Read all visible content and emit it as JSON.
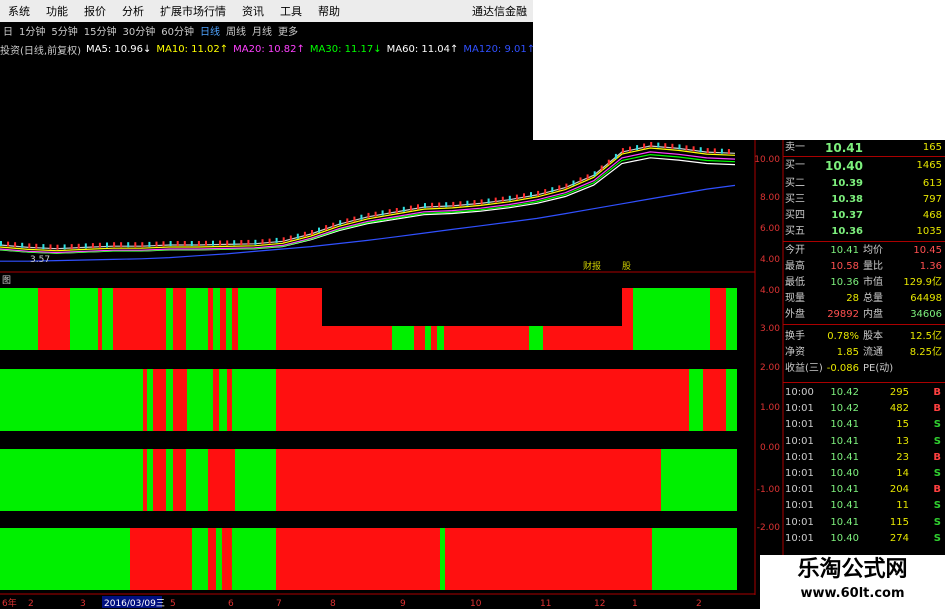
{
  "menu": {
    "items": [
      "系统",
      "功能",
      "报价",
      "分析",
      "扩展市场行情",
      "资讯",
      "工具",
      "帮助"
    ],
    "brand": "通达信金融"
  },
  "periods": {
    "items": [
      "日",
      "1分钟",
      "5分钟",
      "15分钟",
      "30分钟",
      "60分钟",
      "日线",
      "周线",
      "月线",
      "更多"
    ],
    "active_index": 6
  },
  "ma_bar": {
    "title": "投资(日线,前复权)",
    "ma5": "MA5: 10.96↓",
    "ma10": "MA10: 11.02↑",
    "ma20": "MA20: 10.82↑",
    "ma30": "MA30: 11.17↓",
    "ma60": "MA60: 11.04↑",
    "ma120": "MA120: 9.01↑",
    "colors": {
      "ma5": "#ffffff",
      "ma10": "#ffff00",
      "ma20": "#ff40ff",
      "ma30": "#00ff00",
      "ma60": "#ffffff",
      "ma120": "#3050ff"
    }
  },
  "price_chart": {
    "right_axis": [
      "10.00",
      "8.00",
      "6.00",
      "4.00"
    ],
    "low_label": "3.57",
    "markers": [
      "财报",
      "股"
    ],
    "series": {
      "ma120": [
        2.9,
        2.9,
        2.95,
        3.0,
        3.05,
        3.1,
        3.2,
        3.35,
        3.5,
        3.7,
        3.9,
        4.1,
        4.35,
        4.6,
        4.9,
        5.2,
        5.5,
        5.8,
        6.1,
        6.4,
        6.8,
        7.2,
        7.6,
        8.0,
        8.4,
        8.8,
        9.1
      ],
      "price": [
        3.9,
        3.7,
        3.6,
        3.7,
        3.8,
        3.8,
        3.9,
        3.9,
        3.95,
        4.0,
        4.2,
        4.8,
        5.6,
        6.2,
        6.6,
        7.0,
        7.1,
        7.3,
        7.6,
        8.0,
        8.6,
        9.6,
        11.5,
        12.0,
        11.8,
        11.5,
        11.4
      ]
    }
  },
  "indicator": {
    "label": "图",
    "axis_labels": [
      "4.00",
      "3.00",
      "2.00",
      "1.00",
      "0.00",
      "-1.00",
      "-2.00"
    ],
    "colors": {
      "red": "#ff1010",
      "green": "#00f000"
    },
    "rows": [
      {
        "segments": [
          [
            "g",
            0,
            38
          ],
          [
            "r",
            38,
            70
          ],
          [
            "g",
            70,
            98
          ],
          [
            "r",
            98,
            102
          ],
          [
            "g",
            102,
            113
          ],
          [
            "r",
            113,
            166
          ],
          [
            "g",
            166,
            173
          ],
          [
            "r",
            173,
            186
          ],
          [
            "g",
            186,
            208
          ],
          [
            "r",
            208,
            213
          ],
          [
            "g",
            213,
            220
          ],
          [
            "r",
            220,
            226
          ],
          [
            "g",
            226,
            232
          ],
          [
            "r",
            232,
            238
          ],
          [
            "g",
            238,
            276
          ],
          [
            "r",
            276,
            392
          ],
          [
            "g",
            392,
            414
          ],
          [
            "r",
            414,
            425
          ],
          [
            "g",
            425,
            431
          ],
          [
            "r",
            431,
            437
          ],
          [
            "g",
            437,
            444
          ],
          [
            "r",
            444,
            529
          ],
          [
            "g",
            529,
            543
          ],
          [
            "r",
            543,
            633
          ],
          [
            "g",
            633,
            710
          ],
          [
            "r",
            710,
            726
          ],
          [
            "g",
            726,
            737
          ]
        ]
      },
      {
        "segments": [
          [
            "g",
            0,
            143
          ],
          [
            "r",
            143,
            147
          ],
          [
            "g",
            147,
            153
          ],
          [
            "r",
            153,
            166
          ],
          [
            "g",
            166,
            173
          ],
          [
            "r",
            173,
            187
          ],
          [
            "g",
            187,
            213
          ],
          [
            "r",
            213,
            219
          ],
          [
            "g",
            219,
            227
          ],
          [
            "r",
            227,
            232
          ],
          [
            "g",
            232,
            276
          ],
          [
            "r",
            276,
            689
          ],
          [
            "g",
            689,
            703
          ],
          [
            "r",
            703,
            726
          ],
          [
            "g",
            726,
            737
          ]
        ]
      },
      {
        "segments": [
          [
            "g",
            0,
            143
          ],
          [
            "r",
            143,
            147
          ],
          [
            "g",
            147,
            153
          ],
          [
            "r",
            153,
            166
          ],
          [
            "g",
            166,
            173
          ],
          [
            "r",
            173,
            186
          ],
          [
            "g",
            186,
            208
          ],
          [
            "r",
            208,
            235
          ],
          [
            "g",
            235,
            276
          ],
          [
            "r",
            276,
            661
          ],
          [
            "g",
            661,
            737
          ]
        ]
      },
      {
        "segments": [
          [
            "g",
            0,
            130
          ],
          [
            "r",
            130,
            192
          ],
          [
            "g",
            192,
            208
          ],
          [
            "r",
            208,
            216
          ],
          [
            "g",
            216,
            222
          ],
          [
            "r",
            222,
            232
          ],
          [
            "g",
            232,
            276
          ],
          [
            "r",
            276,
            440
          ],
          [
            "g",
            440,
            445
          ],
          [
            "r",
            445,
            652
          ],
          [
            "g",
            652,
            737
          ]
        ]
      }
    ]
  },
  "x_axis": {
    "labels": [
      "6年",
      "2",
      "3",
      "2016/03/09三",
      "5",
      "6",
      "7",
      "8",
      "9",
      "10",
      "11",
      "12",
      "1",
      "2"
    ]
  },
  "quotes": {
    "rows": [
      {
        "label": "卖一",
        "price": "10.41",
        "vol": "165"
      },
      {
        "label": "买一",
        "price": "10.40",
        "vol": "1465"
      },
      {
        "label": "买二",
        "price": "10.39",
        "vol": "613"
      },
      {
        "label": "买三",
        "price": "10.38",
        "vol": "797"
      },
      {
        "label": "买四",
        "price": "10.37",
        "vol": "468"
      },
      {
        "label": "买五",
        "price": "10.36",
        "vol": "1035"
      }
    ]
  },
  "stats": {
    "rows": [
      {
        "l1": "今开",
        "v1": "10.41",
        "l2": "均价",
        "v2": "10.45",
        "c1": "#7df07d",
        "c2": "#ff5050"
      },
      {
        "l1": "最高",
        "v1": "10.58",
        "l2": "量比",
        "v2": "1.36",
        "c1": "#ff5050",
        "c2": "#ff5050"
      },
      {
        "l1": "最低",
        "v1": "10.36",
        "l2": "市值",
        "v2": "129.9亿",
        "c1": "#7df07d",
        "c2": "#e6e600"
      },
      {
        "l1": "现量",
        "v1": "28",
        "l2": "总量",
        "v2": "64498",
        "c1": "#e6e600",
        "c2": "#e6e600"
      },
      {
        "l1": "外盘",
        "v1": "29892",
        "l2": "内盘",
        "v2": "34606",
        "c1": "#ff5050",
        "c2": "#7df07d"
      },
      {
        "l1": "换手",
        "v1": "0.78%",
        "l2": "股本",
        "v2": "12.5亿",
        "c1": "#e6e600",
        "c2": "#e6e600"
      },
      {
        "l1": "净资",
        "v1": "1.85",
        "l2": "流通",
        "v2": "8.25亿",
        "c1": "#e6e600",
        "c2": "#e6e600"
      },
      {
        "l1": "收益(三)",
        "v1": "-0.086",
        "l2": "PE(动)",
        "v2": "",
        "c1": "#e6e600",
        "c2": "#e6e600"
      }
    ]
  },
  "ticks": {
    "rows": [
      {
        "time": "10:00",
        "price": "10.42",
        "vol": "295",
        "side": "B"
      },
      {
        "time": "10:01",
        "price": "10.42",
        "vol": "482",
        "side": "B"
      },
      {
        "time": "10:01",
        "price": "10.41",
        "vol": "15",
        "side": "S"
      },
      {
        "time": "10:01",
        "price": "10.41",
        "vol": "13",
        "side": "S"
      },
      {
        "time": "10:01",
        "price": "10.41",
        "vol": "23",
        "side": "B"
      },
      {
        "time": "10:01",
        "price": "10.40",
        "vol": "14",
        "side": "S"
      },
      {
        "time": "10:01",
        "price": "10.41",
        "vol": "204",
        "side": "B"
      },
      {
        "time": "10:01",
        "price": "10.41",
        "vol": "11",
        "side": "S"
      },
      {
        "time": "10:01",
        "price": "10.41",
        "vol": "115",
        "side": "S"
      },
      {
        "time": "10:01",
        "price": "10.40",
        "vol": "274",
        "side": "S"
      }
    ]
  },
  "watermark": {
    "line1": "乐淘公式网",
    "line2": "www.60lt.com"
  }
}
